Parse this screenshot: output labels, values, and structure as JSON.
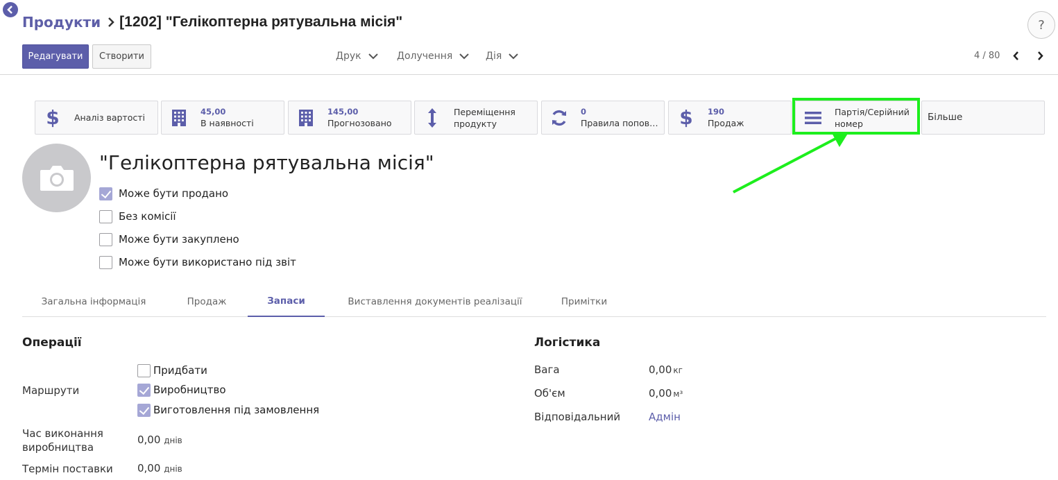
{
  "breadcrumb": {
    "parent": "Продукти",
    "current": "[1202] \"Гелікоптерна рятувальна місія\""
  },
  "help": "?",
  "toolbar": {
    "edit_label": "Редагувати",
    "create_label": "Створити",
    "print_label": "Друк",
    "attach_label": "Долучення",
    "action_label": "Дія"
  },
  "pager": {
    "text": "4 / 80"
  },
  "smart_buttons": [
    {
      "label": "Аналіз вартості",
      "icon": "dollar-icon"
    },
    {
      "value": "45,00",
      "label": "В наявності",
      "icon": "building-icon"
    },
    {
      "value": "145,00",
      "label": "Прогнозовано",
      "icon": "building-icon"
    },
    {
      "line1": "Переміщення",
      "line2": "продукту",
      "icon": "vertical-arrows-icon"
    },
    {
      "value": "0",
      "label": "Правила поповн...",
      "icon": "refresh-icon"
    },
    {
      "value": "190",
      "label": "Продаж",
      "icon": "dollar-icon"
    },
    {
      "line1": "Партія/Серійний",
      "line2": "номер",
      "icon": "list-icon"
    },
    {
      "label": "Більше"
    }
  ],
  "annotation": {
    "highlight_color": "#1dee1d"
  },
  "product": {
    "name": "\"Гелікоптерна рятувальна місія\"",
    "options": [
      {
        "label": "Може бути продано",
        "checked": true
      },
      {
        "label": "Без комісії",
        "checked": false
      },
      {
        "label": "Може бути закуплено",
        "checked": false
      },
      {
        "label": "Може бути використано під звіт",
        "checked": false
      }
    ]
  },
  "tabs": [
    {
      "label": "Загальна інформація",
      "active": false
    },
    {
      "label": "Продаж",
      "active": false
    },
    {
      "label": "Запаси",
      "active": true
    },
    {
      "label": "Виставлення документів реалізації",
      "active": false
    },
    {
      "label": "Примітки",
      "active": false
    }
  ],
  "operations": {
    "title": "Операції",
    "routes_label": "Маршрути",
    "routes": [
      {
        "label": "Придбати",
        "checked": false
      },
      {
        "label": "Виробництво",
        "checked": true
      },
      {
        "label": "Виготовлення під замовлення",
        "checked": true
      }
    ],
    "manufacture_lead_label": "Час виконання виробництва",
    "manufacture_lead_value": "0,00",
    "manufacture_lead_unit": "днів",
    "delivery_lead_label": "Термін поставки",
    "delivery_lead_value": "0,00",
    "delivery_lead_unit": "днів"
  },
  "logistics": {
    "title": "Логістика",
    "weight_label": "Вага",
    "weight_value": "0,00",
    "weight_unit": "кг",
    "volume_label": "Об'єм",
    "volume_value": "0,00",
    "volume_unit": "м³",
    "responsible_label": "Відповідальний",
    "responsible_value": "Адмін"
  },
  "colors": {
    "primary": "#5c5eaa",
    "checked": "#a5a7d6"
  }
}
